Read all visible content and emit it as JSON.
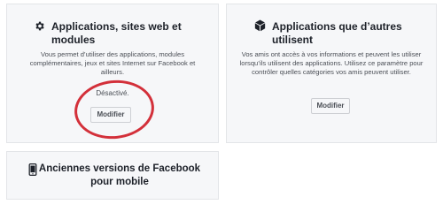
{
  "apps_card": {
    "title": "Applications, sites web et modules",
    "icon": "gear-icon",
    "description": "Vous permet d’utiliser des applications, modules complémentaires, jeux et sites Internet sur Facebook et ailleurs.",
    "status": "Désactivé.",
    "button_label": "Modifier"
  },
  "others_card": {
    "title": "Applications que d’autres utilisent",
    "icon": "box-icon",
    "description": "Vos amis ont accès à vos informations et peuvent les utiliser lorsqu’ils utilisent des applications. Utilisez ce paramètre pour contrôler quelles catégories vos amis peuvent utiliser.",
    "button_label": "Modifier"
  },
  "mobile_card": {
    "title": "Anciennes versions de Facebook pour mobile",
    "icon": "mobile-phone-icon"
  },
  "colors": {
    "annotation_circle": "#d3303a",
    "card_background": "#f6f7f9"
  }
}
